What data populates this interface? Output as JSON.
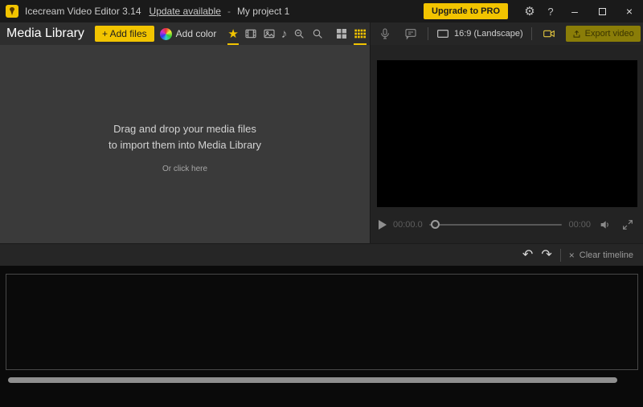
{
  "colors": {
    "accent": "#f2c400",
    "titlebar_bg": "#1a1a1a",
    "toolbar_bg": "#2e2e2e",
    "library_bg": "#3a3a3a",
    "preview_bg": "#232323",
    "timeline_bg": "#0a0a0a"
  },
  "titlebar": {
    "app_title": "Icecream Video Editor 3.14",
    "update_link": "Update available",
    "dash": "-",
    "project_name": "My project 1",
    "upgrade_button": "Upgrade to PRO",
    "help_label": "?"
  },
  "icons": {
    "gear": "⚙",
    "minimize": "–",
    "close": "×",
    "star": "★",
    "music": "♪",
    "undo": "↶",
    "redo": "↷",
    "clear_x": "×"
  },
  "media_toolbar": {
    "panel_title": "Media Library",
    "add_files_button": "+ Add files",
    "add_color_label": "Add color"
  },
  "preview_header": {
    "aspect_label": "16:9 (Landscape)",
    "export_button": "Export video"
  },
  "library": {
    "drop_line1": "Drag and drop your media files",
    "drop_line2": "to import them into Media Library",
    "or_click_label": "Or click here"
  },
  "player": {
    "current_time": "00:00.0",
    "total_time": "00:00"
  },
  "timeline_toolbar": {
    "clear_label": "Clear timeline"
  }
}
